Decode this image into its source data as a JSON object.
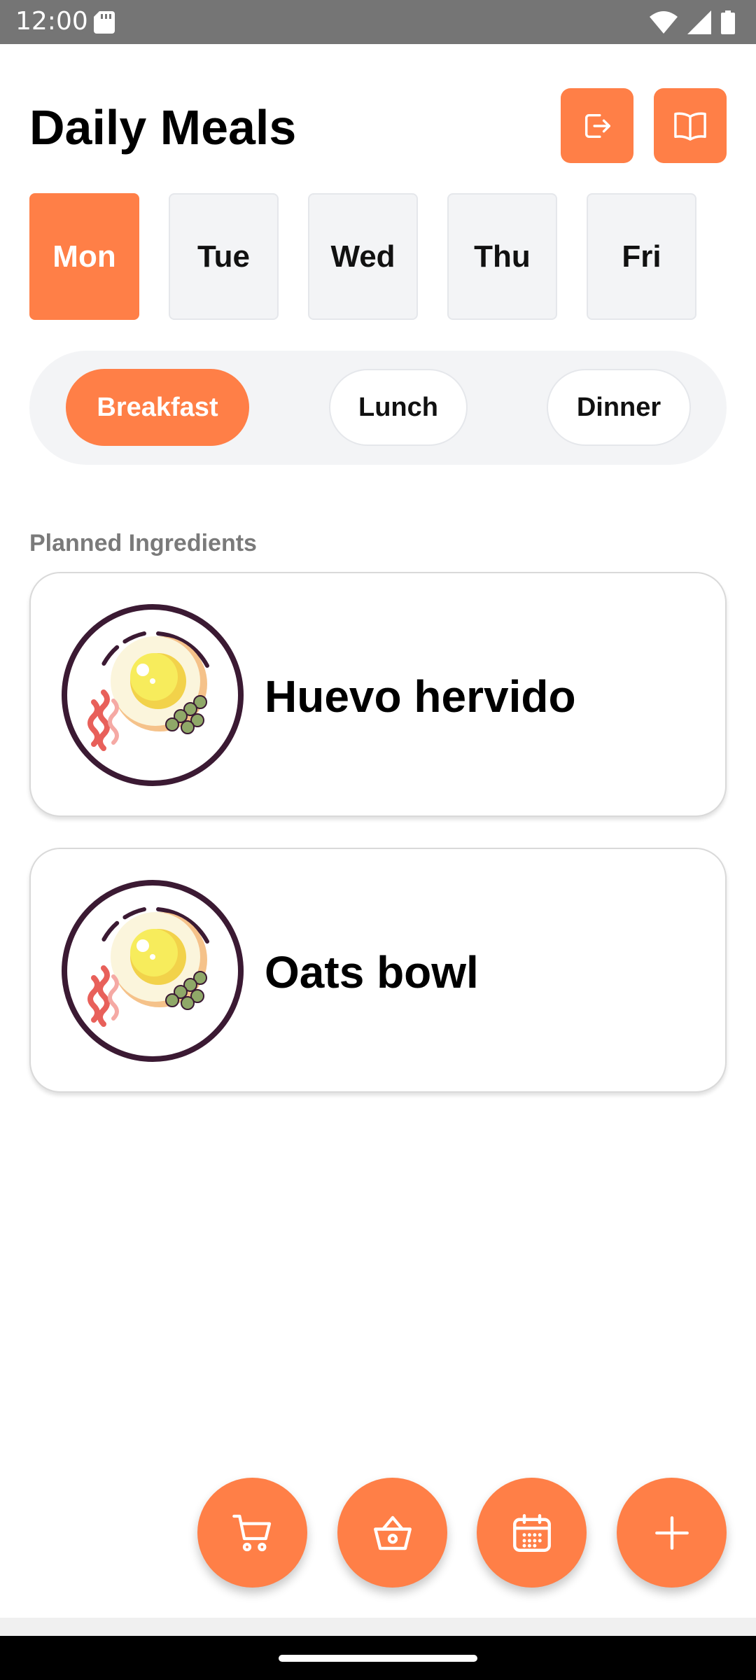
{
  "status_bar": {
    "time": "12:00"
  },
  "header": {
    "title": "Daily Meals"
  },
  "days": [
    {
      "label": "Mon",
      "selected": true
    },
    {
      "label": "Tue",
      "selected": false
    },
    {
      "label": "Wed",
      "selected": false
    },
    {
      "label": "Thu",
      "selected": false
    },
    {
      "label": "Fri",
      "selected": false
    }
  ],
  "meal_types": [
    {
      "label": "Breakfast",
      "selected": true
    },
    {
      "label": "Lunch",
      "selected": false
    },
    {
      "label": "Dinner",
      "selected": false
    }
  ],
  "section": {
    "label": "Planned Ingredients"
  },
  "meals": [
    {
      "name": "Huevo hervido",
      "icon": "breakfast-plate-icon"
    },
    {
      "name": "Oats bowl",
      "icon": "breakfast-plate-icon"
    }
  ],
  "fabs": [
    {
      "icon": "cart-icon"
    },
    {
      "icon": "basket-icon"
    },
    {
      "icon": "calendar-icon"
    },
    {
      "icon": "plus-icon"
    }
  ],
  "colors": {
    "accent": "#ff7f47",
    "status_bar": "#757575",
    "chip_bg": "#f3f4f6",
    "muted_text": "#7a7a7a"
  }
}
